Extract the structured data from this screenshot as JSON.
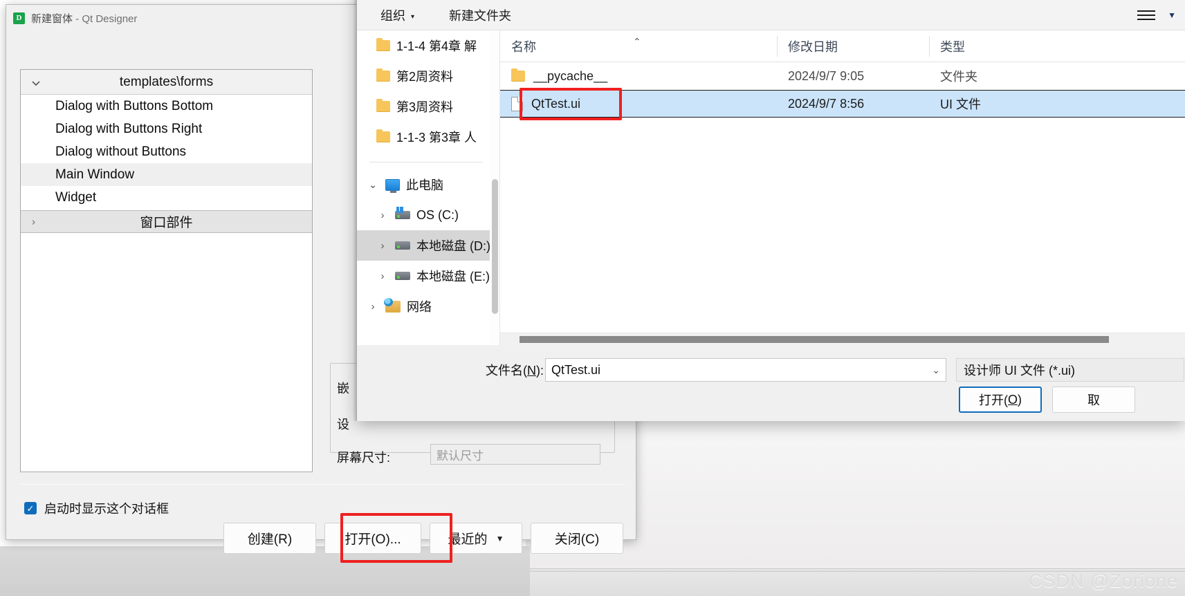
{
  "qt_designer": {
    "title_prefix": "新建窗体",
    "title_suffix": " - Qt Designer",
    "icon_letter": "D",
    "templates_group_label": "templates\\forms",
    "templates": [
      {
        "label": "Dialog with Buttons Bottom"
      },
      {
        "label": "Dialog with Buttons Right"
      },
      {
        "label": "Dialog without Buttons"
      },
      {
        "label": "Main Window"
      },
      {
        "label": "Widget"
      }
    ],
    "selected_template": "Main Window",
    "widgets_group_label": "窗口部件",
    "embedded_label": "嵌",
    "device_label": "设",
    "screen_size_label": "屏幕尺寸:",
    "screen_size_value": "默认尺寸",
    "show_on_startup_label": "启动时显示这个对话框",
    "show_on_startup_checked": true,
    "check_glyph": "✓",
    "buttons": [
      {
        "label": "创建(R)",
        "name": "create"
      },
      {
        "label": "打开(O)...",
        "name": "open"
      },
      {
        "label": "最近的",
        "name": "recent",
        "has_dropdown": true,
        "caret": "▼"
      },
      {
        "label": "关闭(C)",
        "name": "close"
      }
    ],
    "highlighted_button": "打开(O)..."
  },
  "file_dialog": {
    "toolbar": {
      "organize_label": "组织",
      "organize_caret": "▾",
      "new_folder_label": "新建文件夹",
      "view_caret": "▼"
    },
    "nav_pane": {
      "top_folders": [
        {
          "label": "1-1-4 第4章 解"
        },
        {
          "label": "第2周资料"
        },
        {
          "label": "第3周资料"
        },
        {
          "label": "1-1-3 第3章 人"
        }
      ],
      "tree": [
        {
          "label": "此电脑",
          "arrow": "⌄",
          "icon": "pc-icon",
          "level": 0,
          "selected": false
        },
        {
          "label": "OS (C:)",
          "arrow": "›",
          "icon": "drive-os-icon",
          "level": 1,
          "selected": false
        },
        {
          "label": "本地磁盘 (D:)",
          "arrow": "›",
          "icon": "drive-icon",
          "level": 1,
          "selected": true
        },
        {
          "label": "本地磁盘 (E:)",
          "arrow": "›",
          "icon": "drive-icon",
          "level": 1,
          "selected": false
        },
        {
          "label": "网络",
          "arrow": "›",
          "icon": "network-icon",
          "level": 0,
          "selected": false
        }
      ]
    },
    "file_list": {
      "columns": [
        {
          "label": "名称",
          "key": "name"
        },
        {
          "label": "修改日期",
          "key": "date"
        },
        {
          "label": "类型",
          "key": "type"
        }
      ],
      "sort_caret": "⌃",
      "rows": [
        {
          "name": "__pycache__",
          "date": "2024/9/7 9:05",
          "type": "文件夹",
          "icon": "folder-icon",
          "selected": false
        },
        {
          "name": "QtTest.ui",
          "date": "2024/9/7 8:56",
          "type": "UI 文件",
          "icon": "file-icon",
          "selected": true
        }
      ]
    },
    "filename_label_pre": "文件名(",
    "filename_label_key": "N",
    "filename_label_post": "):",
    "filename_value": "QtTest.ui",
    "filename_caret": "⌄",
    "filetype_value": "设计师 UI 文件 (*.ui)",
    "open_button_pre": "打开(",
    "open_button_key": "O",
    "open_button_post": ")",
    "cancel_button_label": "取"
  },
  "watermark": "CSDN @Zorione",
  "colors": {
    "accent_blue": "#0f6cbd",
    "selection_blue": "#cbe4fa",
    "highlight_red": "#ef2020",
    "folder_yellow": "#f7c55a"
  }
}
